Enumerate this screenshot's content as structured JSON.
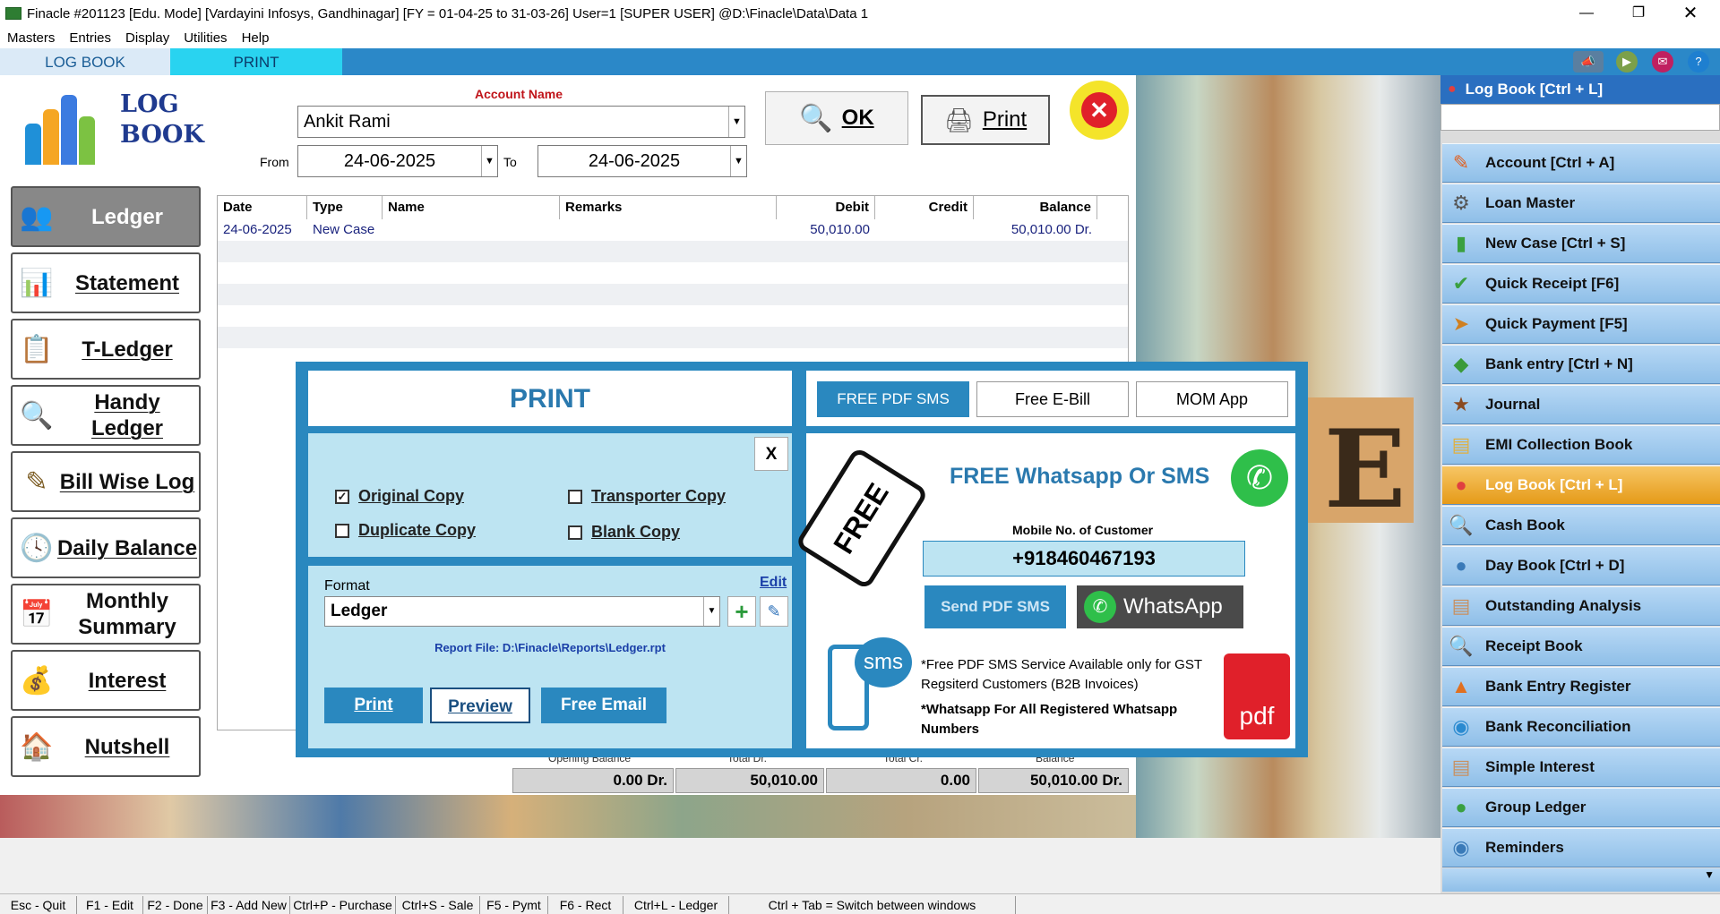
{
  "window": {
    "title": "Finacle #201123  [Edu. Mode]  [Vardayini Infosys, Gandhinagar] [FY = 01-04-25 to 31-03-26] User=1 [SUPER USER]  @D:\\Finacle\\Data\\Data 1"
  },
  "menu": [
    "Masters",
    "Entries",
    "Display",
    "Utilities",
    "Help"
  ],
  "tabs": {
    "log_book": "LOG BOOK",
    "print": "PRINT"
  },
  "logo": {
    "line1": "LOG",
    "line2": "BOOK"
  },
  "form": {
    "account_label": "Account Name",
    "account_value": "Ankit Rami",
    "from_label": "From",
    "from_value": "24-06-2025",
    "to_label": "To",
    "to_value": "24-06-2025",
    "ok_label": "OK",
    "print_label": "Print"
  },
  "left_nav": [
    "Ledger",
    "Statement",
    "T-Ledger",
    "Handy Ledger",
    "Bill Wise Log",
    "Daily Balance",
    "Monthly Summary",
    "Interest",
    "Nutshell"
  ],
  "grid": {
    "headers": [
      "Date",
      "Type",
      "Name",
      "Remarks",
      "Debit",
      "Credit",
      "Balance"
    ],
    "rows": [
      {
        "date": "24-06-2025",
        "type": "New Case",
        "name": "",
        "remarks": "",
        "debit": "50,010.00",
        "credit": "",
        "balance": "50,010.00 Dr."
      }
    ]
  },
  "totals": {
    "labels": [
      "Opening Balance",
      "Total Dr.",
      "Total Cr.",
      "Balance"
    ],
    "values": [
      "0.00 Dr.",
      "50,010.00",
      "0.00",
      "50,010.00 Dr."
    ]
  },
  "dialog": {
    "title": "PRINT",
    "close": "X",
    "copies": [
      {
        "label": "Original Copy",
        "checked": true
      },
      {
        "label": "Transporter Copy",
        "checked": false
      },
      {
        "label": "Duplicate Copy",
        "checked": false
      },
      {
        "label": "Blank Copy",
        "checked": false
      }
    ],
    "format_label": "Format",
    "edit_label": "Edit",
    "format_value": "Ledger",
    "report_file": "Report File: D:\\Finacle\\Reports\\Ledger.rpt",
    "print_btn": "Print",
    "preview_btn": "Preview",
    "email_btn": "Free Email",
    "tabs": [
      "FREE PDF SMS",
      "Free E-Bill",
      "MOM App"
    ],
    "free_tag": "FREE",
    "promo_title": "FREE Whatsapp Or SMS",
    "mobile_label": "Mobile No. of Customer",
    "mobile_value": "+918460467193",
    "send_sms_btn": "Send PDF SMS",
    "whatsapp_btn": "WhatsApp",
    "sms_icon_text": "sms",
    "note1": "*Free PDF SMS Service Available only for GST  Regsiterd  Customers (B2B Invoices)",
    "note2": "*Whatsapp For All Registered Whatsapp Numbers",
    "pdf_icon_text": "pdf"
  },
  "right_panel": {
    "header": "Log Book [Ctrl + L]",
    "items": [
      "Account [Ctrl + A]",
      "Loan Master",
      "New Case [Ctrl + S]",
      "Quick Receipt [F6]",
      "Quick Payment [F5]",
      "Bank entry [Ctrl + N]",
      "Journal",
      "EMI Collection Book",
      "Log Book [Ctrl + L]",
      "Cash Book",
      "Day Book [Ctrl + D]",
      "Outstanding Analysis",
      "Receipt Book",
      "Bank Entry Register",
      "Bank Reconciliation",
      "Simple Interest",
      "Group Ledger",
      "Reminders"
    ],
    "selected_index": 8
  },
  "status_bar": [
    "Esc - Quit",
    "F1 - Edit",
    "F2 - Done",
    "F3 - Add New",
    "Ctrl+P - Purchase",
    "Ctrl+S - Sale",
    "F5 - Pymt",
    "F6 - Rect",
    "Ctrl+L - Ledger",
    "Ctrl + Tab = Switch between windows"
  ]
}
